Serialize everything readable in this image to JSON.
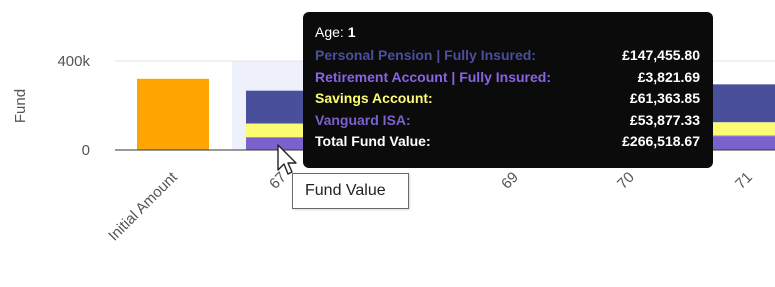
{
  "chart_data": {
    "type": "bar",
    "stacked": true,
    "ylabel": "Fund",
    "yticks": [
      {
        "value": 0,
        "label": "0"
      },
      {
        "value": 400000,
        "label": "400k"
      }
    ],
    "categories": [
      "Initial Amount",
      "67",
      "",
      "69",
      "70",
      "71"
    ],
    "series": [
      {
        "name": "Personal Pension | Fully Insured",
        "color": "#4a4f9c",
        "values": [
          0,
          147455.8,
          0,
          0,
          0,
          170000
        ]
      },
      {
        "name": "Retirement Account | Fully Insured",
        "color": "#8a63e6",
        "values": [
          0,
          3821.69,
          0,
          0,
          0,
          5000
        ]
      },
      {
        "name": "Savings Account",
        "color": "#fbfc74",
        "values": [
          0,
          61363.85,
          0,
          0,
          0,
          60000
        ]
      },
      {
        "name": "Vanguard ISA",
        "color": "#7a61cc",
        "values": [
          0,
          53877.33,
          0,
          0,
          0,
          60000
        ]
      },
      {
        "name": "",
        "color": "#ffa500",
        "values": [
          320000,
          0,
          0,
          0,
          0,
          0
        ]
      }
    ],
    "grid": true
  },
  "tooltip": {
    "title_label": "Age: ",
    "title_value": "1",
    "rows": [
      {
        "label": "Personal Pension | Fully Insured:",
        "value": "£147,455.80",
        "color": "#4a4f9c"
      },
      {
        "label": "Retirement Account | Fully Insured:",
        "value": "£3,821.69",
        "color": "#8a63e6"
      },
      {
        "label": "Savings Account:",
        "value": "£61,363.85",
        "color": "#fbfc74"
      },
      {
        "label": "Vanguard ISA:",
        "value": "£53,877.33",
        "color": "#7a61cc"
      },
      {
        "label": "Total Fund Value:",
        "value": "£266,518.67",
        "color": "#ffffff"
      }
    ]
  },
  "hint": {
    "text": "Fund Value"
  },
  "icons": {
    "cursor": "mouse-pointer-icon"
  }
}
